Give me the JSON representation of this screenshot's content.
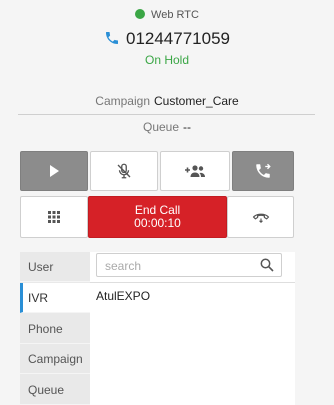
{
  "header": {
    "status_label": "Web RTC",
    "status_color": "#3aa645",
    "phone_number": "01244771059",
    "call_state": "On Hold"
  },
  "info": {
    "campaign_label": "Campaign",
    "campaign_value": "Customer_Care",
    "queue_label": "Queue",
    "queue_value": "--"
  },
  "controls": {
    "row1": [
      {
        "name": "resume-play",
        "icon": "play-icon"
      },
      {
        "name": "mute",
        "icon": "mic-muted-icon"
      },
      {
        "name": "add-participant",
        "icon": "add-users-icon"
      },
      {
        "name": "transfer-call",
        "icon": "phone-forward-icon"
      }
    ],
    "dialpad_icon": "dialpad-icon",
    "end_call_label": "End Call",
    "call_timer": "00:00:10",
    "hangup_icon": "hangup-icon"
  },
  "transfer_panel": {
    "tabs": [
      "User",
      "IVR",
      "Phone",
      "Campaign",
      "Queue"
    ],
    "active_tab": "IVR",
    "search_placeholder": "search",
    "items": [
      "AtulEXPO"
    ]
  },
  "colors": {
    "accent_blue": "#2a8fd6",
    "end_call_red": "#d62127",
    "online_green": "#3aa645"
  }
}
